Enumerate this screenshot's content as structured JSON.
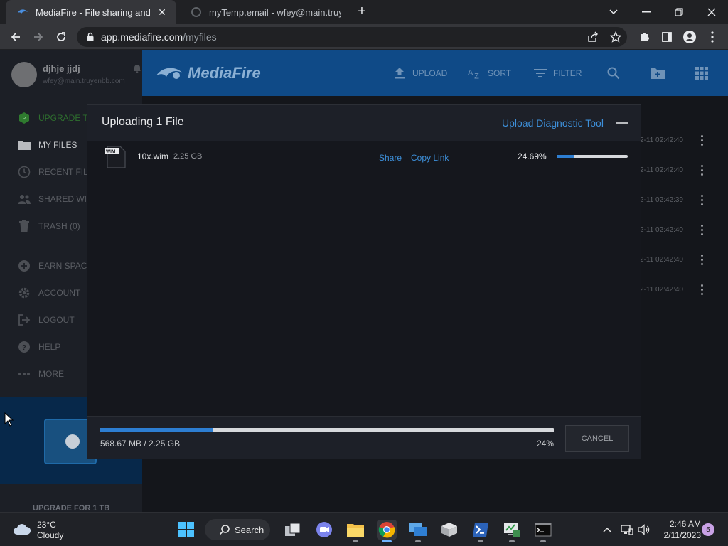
{
  "browser": {
    "tabs": [
      {
        "title": "MediaFire - File sharing and storage",
        "active": true
      },
      {
        "title": "myTemp.email - wfey@main.truyenbb.com",
        "active": false
      }
    ],
    "url_host": "app.mediafire.com",
    "url_path": "/myfiles"
  },
  "sidebar": {
    "profile": {
      "name": "djhje jjdj",
      "email": "wfey@main.truyenbb.com"
    },
    "items": [
      {
        "label": "Upgrade to"
      },
      {
        "label": "My Files"
      },
      {
        "label": "Recent Files"
      },
      {
        "label": "Shared with"
      },
      {
        "label": "Trash (0)"
      },
      {
        "label": "Earn Space"
      },
      {
        "label": "Account"
      },
      {
        "label": "Logout"
      },
      {
        "label": "Help"
      },
      {
        "label": "More"
      }
    ],
    "upgrade_label": "UPGRADE FOR 1 TB"
  },
  "header": {
    "logo": "MediaFire",
    "upload_label": "UPLOAD",
    "sort_label": "SORT",
    "filter_label": "FILTER"
  },
  "file_list_dates": [
    "2-11 02:42:40",
    "2-11 02:42:40",
    "2-11 02:42:39",
    "2-11 02:42:40",
    "2-11 02:42:40",
    "2-11 02:42:40"
  ],
  "upload_modal": {
    "title": "Uploading 1 File",
    "diagnostic_link": "Upload Diagnostic Tool",
    "file": {
      "icon_label": "WIM",
      "name": "10x.wim",
      "size": "2.25 GB",
      "share_label": "Share",
      "copy_link_label": "Copy Link",
      "percent_text": "24.69%",
      "progress": 24.69
    },
    "total": {
      "size_text": "568.67 MB / 2.25 GB",
      "percent_text": "24%",
      "progress": 24.69
    },
    "cancel_label": "CANCEL"
  },
  "taskbar": {
    "weather_temp": "23°C",
    "weather_desc": "Cloudy",
    "search_label": "Search",
    "time": "2:46 AM",
    "date": "2/11/2023",
    "notification_count": "5"
  },
  "colors": {
    "accent_blue": "#2d7ed2",
    "link_blue": "#3d8fd9",
    "header_blue": "#0f4a87"
  }
}
